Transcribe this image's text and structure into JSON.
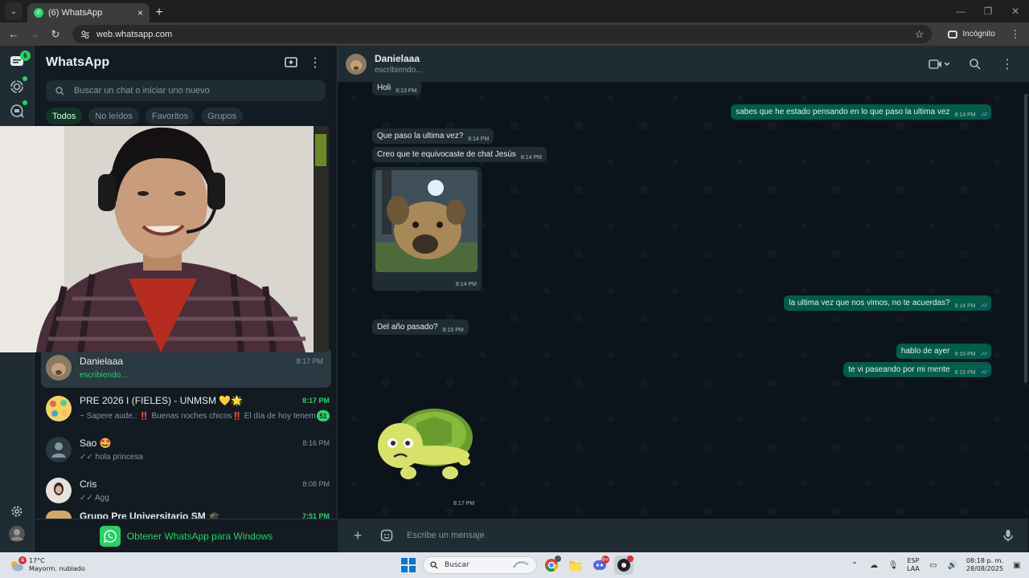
{
  "browser": {
    "tab_title": "(6) WhatsApp",
    "tab_close": "×",
    "new_tab": "+",
    "url": "web.whatsapp.com",
    "incognito_label": "Incógnito"
  },
  "rail": {
    "chats_badge": "6"
  },
  "sidebar": {
    "title": "WhatsApp",
    "search_placeholder": "Buscar un chat o iniciar uno nuevo",
    "filters": [
      "Todos",
      "No leídos",
      "Favoritos",
      "Grupos"
    ],
    "chats": [
      {
        "name": "Danielaaa",
        "time": "8:17 PM",
        "preview": "escribiendo..."
      },
      {
        "name": "PRE 2026 I (FIELES) - UNMSM 💛🌟",
        "time": "8:17 PM",
        "preview": "~ Sapere aude.: ‼️ Buenas noches chicos‼️ El día de hoy tenem...",
        "unread": "51"
      },
      {
        "name": "Sao 🤩",
        "time": "8:16 PM",
        "preview": "hola princesa"
      },
      {
        "name": "Cris",
        "time": "8:08 PM",
        "preview": "Agg"
      },
      {
        "name": "Grupo Pre Universitario SM 🎓",
        "time": "7:51 PM"
      }
    ],
    "promo": "Obtener WhatsApp para Windows"
  },
  "conversation": {
    "contact_name": "Danielaaa",
    "status": "escribiendo...",
    "messages": [
      {
        "dir": "in",
        "text": "Holi",
        "time": "8:13 PM"
      },
      {
        "dir": "out",
        "text": "sabes que he estado pensando en lo que paso la ultima vez",
        "time": "8:14 PM"
      },
      {
        "dir": "in",
        "text": "Que paso la ultima vez?",
        "time": "8:14 PM"
      },
      {
        "dir": "in",
        "text": "Creo que te equivocaste de chat Jesús",
        "time": "8:14 PM"
      },
      {
        "dir": "in",
        "text": "",
        "time": "8:14 PM"
      },
      {
        "dir": "out",
        "text": "la ultima vez que nos vimos, no te acuerdas?",
        "time": "8:14 PM"
      },
      {
        "dir": "in",
        "text": "Del año pasado?",
        "time": "8:15 PM"
      },
      {
        "dir": "out",
        "text": "hablo de ayer",
        "time": "8:15 PM"
      },
      {
        "dir": "out",
        "text": "te vi paseando por mi mente",
        "time": "8:15 PM"
      },
      {
        "dir": "in",
        "text": "",
        "time": "8:17 PM"
      }
    ],
    "composer_placeholder": "Escribe un mensaje"
  },
  "taskbar": {
    "weather_temp": "17°C",
    "weather_desc": "Mayorm. nublado",
    "weather_badge": "4",
    "search_label": "Buscar",
    "chrome_badge": "",
    "discord_badge": "9+",
    "lang_top": "ESP",
    "lang_bottom": "LAA",
    "time": "08:18 p. m.",
    "date": "28/08/2025"
  },
  "colors": {
    "accent": "#25d366",
    "outgoing": "#005c4b",
    "incoming": "#202c33",
    "background": "#111b21"
  }
}
